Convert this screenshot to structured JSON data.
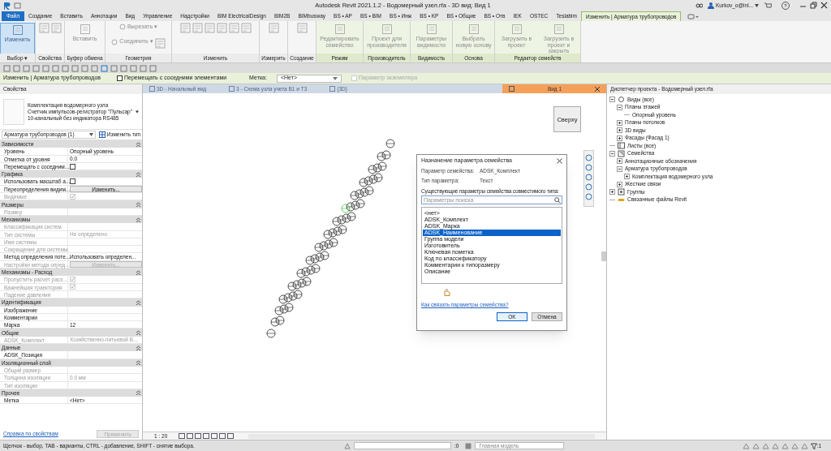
{
  "window": {
    "title": "Autodesk Revit 2021.1.2 - Водомерный узел.rfa - 3D вид: Вид 1",
    "user": "Kurkov_o@inl...",
    "help": "?"
  },
  "ribbon_tabs": [
    {
      "label": "Файл",
      "kind": "file",
      "selected": false
    },
    {
      "label": "Создание",
      "kind": "tab",
      "selected": false
    },
    {
      "label": "Вставить",
      "kind": "tab",
      "selected": false
    },
    {
      "label": "Аннотации",
      "kind": "tab",
      "selected": false
    },
    {
      "label": "Вид",
      "kind": "tab",
      "selected": false
    },
    {
      "label": "Управление",
      "kind": "tab",
      "selected": false
    },
    {
      "label": "Надстройки",
      "kind": "tab",
      "selected": false
    },
    {
      "label": "BIM ElectricalDesign",
      "kind": "tab",
      "selected": false
    },
    {
      "label": "BIM2B",
      "kind": "tab",
      "selected": false
    },
    {
      "label": "BIMbusway",
      "kind": "tab",
      "selected": false
    },
    {
      "label": "BS • AP",
      "kind": "tab",
      "selected": false
    },
    {
      "label": "BS • BIM",
      "kind": "tab",
      "selected": false
    },
    {
      "label": "BS • Инж",
      "kind": "tab",
      "selected": false
    },
    {
      "label": "BS • KP",
      "kind": "tab",
      "selected": false
    },
    {
      "label": "BS • Общие",
      "kind": "tab",
      "selected": false
    },
    {
      "label": "BS • Отв",
      "kind": "tab",
      "selected": false
    },
    {
      "label": "IEK",
      "kind": "tab",
      "selected": false
    },
    {
      "label": "OSTEC",
      "kind": "tab",
      "selected": false
    },
    {
      "label": "Teslabim",
      "kind": "tab",
      "selected": false
    },
    {
      "label": "Изменить | Арматура трубопроводов",
      "kind": "contextual",
      "selected": true
    }
  ],
  "ribbon_panels": [
    {
      "label": "Выбор ▾",
      "contextual": false,
      "buttons": [
        {
          "kind": "large",
          "label": "Изменить",
          "active": true,
          "disabled": false
        }
      ]
    },
    {
      "label": "Свойства",
      "contextual": false,
      "buttons": [
        {
          "kind": "icon"
        },
        {
          "kind": "icon"
        }
      ]
    },
    {
      "label": "Буфер обмена",
      "contextual": false,
      "buttons": [
        {
          "kind": "large",
          "label": "Вставить",
          "active": false,
          "disabled": true
        },
        {
          "kind": "icon"
        }
      ]
    },
    {
      "label": "Геометрия",
      "contextual": false,
      "buttons": [
        {
          "kind": "small",
          "label": "Вырезать ▾",
          "active": false,
          "disabled": true
        },
        {
          "kind": "small",
          "label": "Соединить ▾",
          "active": false,
          "disabled": true
        },
        {
          "kind": "icon"
        }
      ]
    },
    {
      "label": "Изменить",
      "contextual": false,
      "buttons": [
        {
          "kind": "icon"
        },
        {
          "kind": "icon"
        },
        {
          "kind": "icon"
        },
        {
          "kind": "icon"
        },
        {
          "kind": "icon"
        },
        {
          "kind": "icon"
        }
      ]
    },
    {
      "label": "Измерить",
      "contextual": false,
      "buttons": [
        {
          "kind": "icon"
        }
      ]
    },
    {
      "label": "Создание",
      "contextual": false,
      "buttons": [
        {
          "kind": "icon"
        }
      ]
    },
    {
      "label": "Режим",
      "contextual": true,
      "buttons": [
        {
          "kind": "large",
          "label": "Редактировать семейство",
          "active": false,
          "disabled": true
        }
      ]
    },
    {
      "label": "Производитель",
      "contextual": true,
      "buttons": [
        {
          "kind": "large",
          "label": "Проект для производителя",
          "active": false,
          "disabled": true
        }
      ]
    },
    {
      "label": "Видимость",
      "contextual": true,
      "buttons": [
        {
          "kind": "large",
          "label": "Параметры видимости",
          "active": false,
          "disabled": true
        }
      ]
    },
    {
      "label": "Основа",
      "contextual": true,
      "buttons": [
        {
          "kind": "large",
          "label": "Выбрать новую основу",
          "active": false,
          "disabled": true
        }
      ]
    },
    {
      "label": "Редактор семейств",
      "contextual": true,
      "buttons": [
        {
          "kind": "large",
          "label": "Загрузить в проект",
          "active": false,
          "disabled": true
        },
        {
          "kind": "large",
          "label": "Загрузить в проект и закрыть",
          "active": false,
          "disabled": true
        }
      ]
    }
  ],
  "options_bar": {
    "context": "Изменить | Арматура трубопроводов",
    "move_with_neighbors": {
      "label": "Перемещать с соседними элементами",
      "checked": false
    },
    "tag_label": "Метка:",
    "tag_value": "<Нет>",
    "instance_param": {
      "label": "Параметр экземпляра",
      "checked": false,
      "disabled": true
    }
  },
  "properties": {
    "title": "Свойства",
    "type_lines": [
      "Комплектация водомерного узла",
      "Счетчик импульсов-регистратор \"Пульсар\"",
      "10-канальный без индикатора RS485"
    ],
    "selector": "Арматура трубопроводов (1)",
    "edit_type": "Изменить тип",
    "groups": [
      {
        "name": "Зависимости",
        "rows": [
          {
            "label": "Уровень",
            "kind": "text",
            "value": "Опорный уровень",
            "disabled": false
          },
          {
            "label": "Отметка от уровня",
            "kind": "text",
            "value": "0.0",
            "disabled": false
          },
          {
            "label": "Перемещать с соседним...",
            "kind": "checkbox",
            "checked": false,
            "disabled": false
          }
        ]
      },
      {
        "name": "Графика",
        "rows": [
          {
            "label": "Использовать масштаб а...",
            "kind": "checkbox",
            "checked": false,
            "disabled": false
          },
          {
            "label": "Переопределения видим...",
            "kind": "button",
            "value": "Изменить...",
            "disabled": false
          },
          {
            "label": "Видимые",
            "kind": "checkbox",
            "checked": true,
            "disabled": true
          }
        ]
      },
      {
        "name": "Размеры",
        "rows": [
          {
            "label": "Размер",
            "kind": "text",
            "disabled": true
          }
        ]
      },
      {
        "name": "Механизмы",
        "rows": [
          {
            "label": "Классификация систем",
            "kind": "text",
            "disabled": true
          },
          {
            "label": "Тип системы",
            "kind": "text",
            "value": "Не определено",
            "disabled": true
          },
          {
            "label": "Имя системы",
            "kind": "text",
            "disabled": true
          },
          {
            "label": "Сокращение для системы",
            "kind": "text",
            "disabled": true
          },
          {
            "label": "Метод определения поте...",
            "kind": "text",
            "value": "Использовать определен...",
            "disabled": false
          },
          {
            "label": "Настройки метода опред...",
            "kind": "button",
            "value": "Изменить...",
            "disabled": true
          }
        ]
      },
      {
        "name": "Механизмы - Расход",
        "rows": [
          {
            "label": "Пропустить расчет расх...",
            "kind": "checkbox",
            "checked": true,
            "disabled": true
          },
          {
            "label": "Важнейшая траектория",
            "kind": "checkbox",
            "checked": true,
            "disabled": true
          },
          {
            "label": "Падение давления",
            "kind": "text",
            "disabled": true
          }
        ]
      },
      {
        "name": "Идентификация",
        "rows": [
          {
            "label": "Изображение",
            "kind": "text",
            "disabled": false
          },
          {
            "label": "Комментарии",
            "kind": "text",
            "disabled": false
          },
          {
            "label": "Марка",
            "kind": "text",
            "value": "12",
            "disabled": false
          }
        ]
      },
      {
        "name": "Общие",
        "rows": [
          {
            "label": "ADSK_Комплект",
            "kind": "text",
            "value": "Хозяйственно-питьевой В...",
            "disabled": true
          }
        ]
      },
      {
        "name": "Данные",
        "rows": [
          {
            "label": "ADSK_Позиция",
            "kind": "text",
            "disabled": false
          }
        ]
      },
      {
        "name": "Изоляционный слой",
        "rows": [
          {
            "label": "Общий размер",
            "kind": "text",
            "disabled": true
          },
          {
            "label": "Толщина изоляции",
            "kind": "text",
            "value": "0.0 мм",
            "disabled": true
          },
          {
            "label": "Тип изоляции",
            "kind": "text",
            "disabled": true
          }
        ]
      },
      {
        "name": "Прочее",
        "rows": [
          {
            "label": "Метка",
            "kind": "text",
            "value": "<Нет>",
            "disabled": false
          }
        ]
      }
    ],
    "help_link": "Справка по свойствам",
    "apply": {
      "label": "Применить",
      "disabled": true
    }
  },
  "view_tabs": [
    {
      "label": "3D - Начальный вид",
      "selected": false
    },
    {
      "label": "3 - Схема узла учета В1 и Т3",
      "selected": false
    },
    {
      "label": "{3D}",
      "selected": false
    },
    {
      "label": "Вид 1",
      "selected": true
    }
  ],
  "view_cube": {
    "face": "Сверху"
  },
  "view_control": {
    "scale": "1 : 20"
  },
  "dialog": {
    "title": "Назначение параметра семейства",
    "param_label": "Параметр семейства:",
    "param_value": "ADSK_Комплект",
    "type_label": "Тип параметра:",
    "type_value": "Текст",
    "list_label": "Существующие параметры семейства совместимого типа:",
    "search": {
      "placeholder": "Параметры поиска"
    },
    "items": [
      {
        "label": "<нет>",
        "selected": false
      },
      {
        "label": "ADSK_Комплект",
        "selected": false
      },
      {
        "label": "ADSK_Марка",
        "selected": false
      },
      {
        "label": "ADSK_Наименование",
        "selected": true
      },
      {
        "label": "Группа модели",
        "selected": false
      },
      {
        "label": "Изготовитель",
        "selected": false
      },
      {
        "label": "Ключевая пометка",
        "selected": false
      },
      {
        "label": "Код по классификатору",
        "selected": false
      },
      {
        "label": "Комментарии к типоразмеру",
        "selected": false
      },
      {
        "label": "Описание",
        "selected": false
      }
    ],
    "help_link": "Как связать параметры семейства?",
    "buttons": [
      "OK",
      "Отмена"
    ]
  },
  "project_browser": {
    "title": "Диспетчер проекта - Водомерный узел.rfa",
    "tree": [
      {
        "label": "Виды (все)",
        "expanded": true,
        "children": [
          {
            "label": "Планы этажей",
            "expanded": true,
            "children": [
              {
                "label": "Опорный уровень"
              }
            ]
          },
          {
            "label": "Планы потолков",
            "expanded": false
          },
          {
            "label": "3D виды",
            "expanded": false
          },
          {
            "label": "Фасады (Фасад 1)",
            "expanded": false
          }
        ]
      },
      {
        "label": "Листы (все)"
      },
      {
        "label": "Семейства",
        "expanded": true,
        "children": [
          {
            "label": "Аннотационные обозначения",
            "expanded": false
          },
          {
            "label": "Арматура трубопроводов",
            "expanded": true,
            "children": [
              {
                "label": "Комплектация водомерного узла",
                "expanded": false
              }
            ]
          },
          {
            "label": "Жесткие связи",
            "expanded": false
          }
        ]
      },
      {
        "label": "Группы",
        "expanded": false
      },
      {
        "label": "Связанные файлы Revit"
      }
    ]
  },
  "status_bar": {
    "hint": "Щелчок - выбор, TAB - варианты, CTRL - добавление, SHIFT - снятие выбора.",
    "worksets": ":0",
    "model": "Главная модель",
    "filter": ":1"
  }
}
